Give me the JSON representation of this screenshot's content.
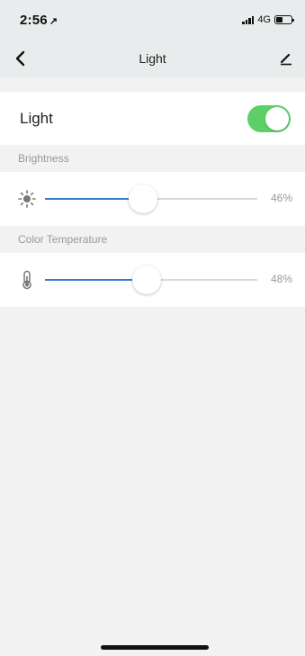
{
  "status_bar": {
    "time": "2:56",
    "location_arrow": "↗",
    "network": "4G"
  },
  "nav": {
    "title": "Light",
    "back_icon": "chevron-left-icon",
    "edit_icon": "pencil-icon"
  },
  "light_row": {
    "label": "Light",
    "toggle_on": true,
    "toggle_color": "#5ccf67"
  },
  "brightness": {
    "section_label": "Brightness",
    "icon": "sun-icon",
    "value": 0.46,
    "value_text": "46%"
  },
  "color_temperature": {
    "section_label": "Color Temperature",
    "icon": "thermometer-icon",
    "value": 0.48,
    "value_text": "48%"
  },
  "colors": {
    "accent_fill": "#3a78c8",
    "background": "#f2f2f2"
  }
}
